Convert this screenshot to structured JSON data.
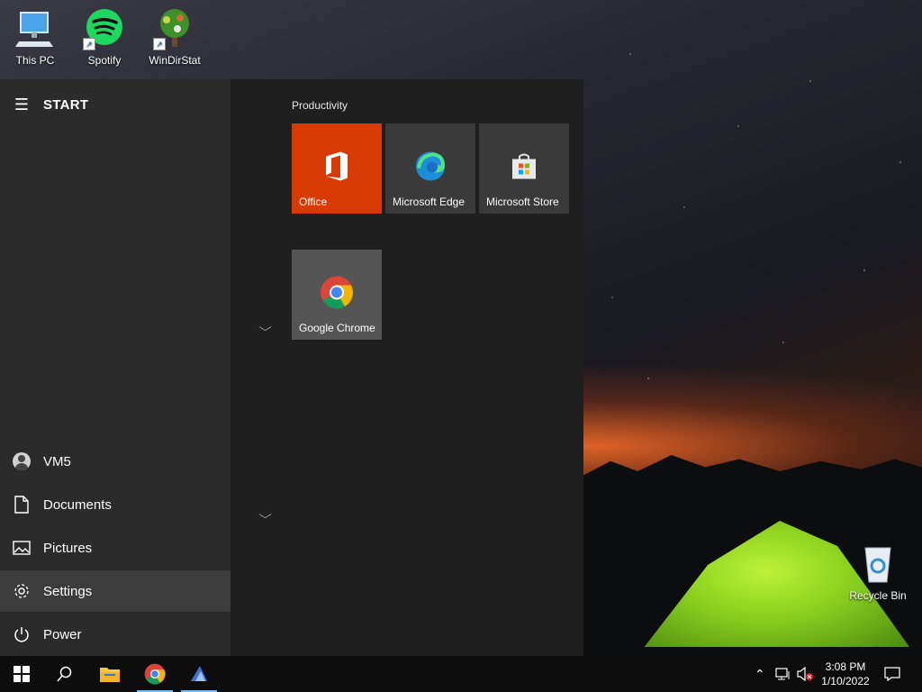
{
  "desktop": {
    "icons": [
      {
        "label": "This PC"
      },
      {
        "label": "Spotify"
      },
      {
        "label": "WinDirStat"
      },
      {
        "label": "Recycle Bin"
      }
    ]
  },
  "start_menu": {
    "title": "START",
    "user": "VM5",
    "items": [
      {
        "label": "Documents",
        "icon": "document-icon"
      },
      {
        "label": "Pictures",
        "icon": "pictures-icon"
      },
      {
        "label": "Settings",
        "icon": "gear-icon"
      },
      {
        "label": "Power",
        "icon": "power-icon"
      }
    ],
    "group_title": "Productivity",
    "tiles": [
      {
        "label": "Office",
        "color": "#d83b01"
      },
      {
        "label": "Microsoft Edge",
        "color": "#3a3a3a"
      },
      {
        "label": "Microsoft Store",
        "color": "#3a3a3a"
      },
      {
        "label": "Google Chrome",
        "color": "#555555"
      }
    ]
  },
  "taskbar": {
    "clock_time": "3:08 PM",
    "clock_date": "1/10/2022"
  },
  "colors": {
    "accent": "#76b9ed",
    "office": "#d83b01"
  }
}
